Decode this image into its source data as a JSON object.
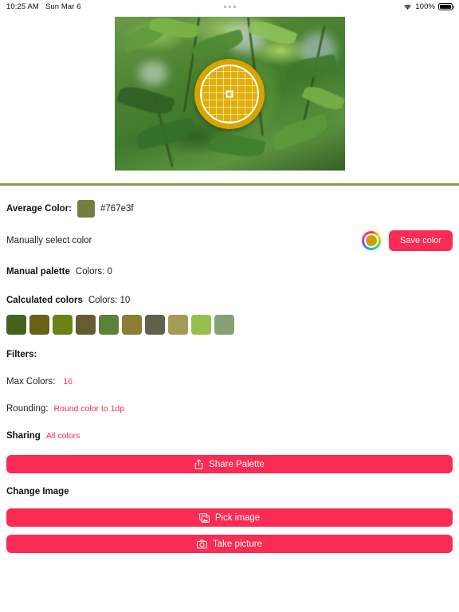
{
  "statusbar": {
    "time": "10:25 AM",
    "date": "Sun Mar 6",
    "battery_percent": "100%",
    "wifi_icon": "wifi-icon",
    "battery_icon": "battery-icon",
    "multitask_handle": "multitask-handle-icon"
  },
  "photo": {
    "description": "green leaves photo",
    "loupe_icon": "color-picker-loupe-icon",
    "loupe_color": "#d9a400"
  },
  "average": {
    "label": "Average Color:",
    "hex": "#767e3f",
    "swatch_color": "#767e3f"
  },
  "manual_select": {
    "label": "Manually select color",
    "wheel_icon": "color-wheel-icon",
    "save_label": "Save color"
  },
  "manual_palette": {
    "label": "Manual palette",
    "count_label": "Colors: 0"
  },
  "calculated": {
    "label": "Calculated colors",
    "count_label": "Colors: 10",
    "swatches": [
      "#46621e",
      "#6a6016",
      "#6a8319",
      "#655c36",
      "#5d8137",
      "#8a7e31",
      "#60604d",
      "#a49b56",
      "#97bf4e",
      "#87a077"
    ]
  },
  "filters": {
    "label": "Filters:",
    "max_colors_label": "Max Colors:",
    "max_colors_value": "16",
    "rounding_label": "Rounding:",
    "rounding_value": "Round color to 1dp"
  },
  "sharing": {
    "label": "Sharing",
    "value": "All colors",
    "share_button_label": "Share Palette",
    "share_icon": "share-icon"
  },
  "change_image": {
    "label": "Change Image",
    "pick_label": "Pick image",
    "pick_icon": "photo-library-icon",
    "take_label": "Take picture",
    "take_icon": "camera-icon"
  },
  "colors": {
    "accent": "#fb2b53",
    "divider": "#8f9459"
  }
}
